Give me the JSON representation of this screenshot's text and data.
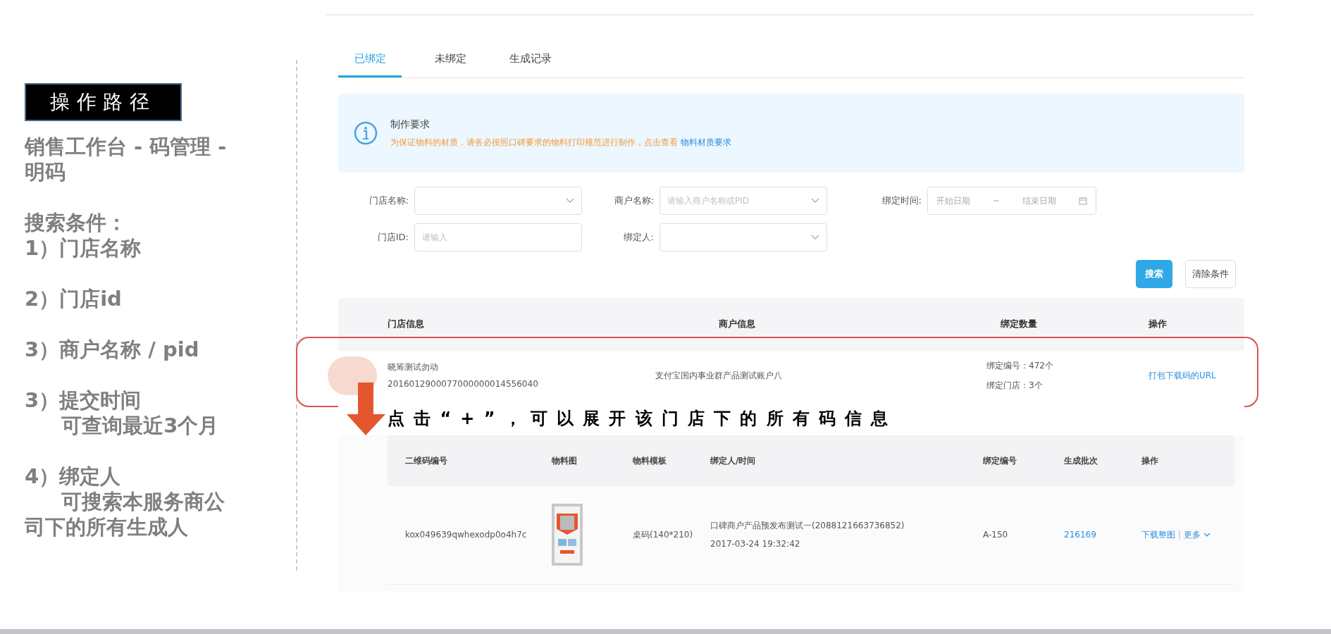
{
  "guide": {
    "badge": "操作路径",
    "path": "销售工作台 - 码管理 - 明码",
    "conditions_title": "搜索条件：",
    "conditions": [
      {
        "label": "1）门店名称"
      },
      {
        "label": "2）门店id"
      },
      {
        "label": "3）商户名称 / pid"
      },
      {
        "label": "3）提交时间",
        "note": "可查询最近3个月"
      },
      {
        "label": "4）绑定人",
        "note": "可搜索本服务商公司下的所有生成人"
      }
    ]
  },
  "tabs": [
    {
      "label": "已绑定",
      "selected": true
    },
    {
      "label": "未绑定",
      "selected": false
    },
    {
      "label": "生成记录",
      "selected": false
    }
  ],
  "notice": {
    "title": "制作要求",
    "text": "为保证物料的材质，请务必按照口碑要求的物料打印规范进行制作，点击查看",
    "link": "物料材质要求"
  },
  "filters": [
    {
      "kind": "select",
      "label": "门店名称:"
    },
    {
      "kind": "select",
      "label": "商户名称:",
      "placeholder": "请输入商户名称或PID"
    },
    {
      "kind": "range",
      "label": "绑定时间:",
      "start": "开始日期",
      "separator": "~",
      "end": "结束日期"
    },
    {
      "kind": "input",
      "label": "门店ID:",
      "placeholder": "请输入"
    },
    {
      "kind": "select",
      "label": "绑定人:"
    }
  ],
  "buttons": [
    {
      "label": "搜索",
      "kind": "primary"
    },
    {
      "label": "清除条件",
      "kind": "default"
    }
  ],
  "table": {
    "columns": [
      "门店信息",
      "商户信息",
      "绑定数量",
      "操作"
    ],
    "row": {
      "store_name": "晓筹测试勿动",
      "store_id": "2016012900077000000014556040",
      "merchant": "支付宝国内事业群产品测试账户八",
      "counts": [
        "绑定编号：472个",
        "绑定门店：3个"
      ],
      "action": "打包下载码的URL"
    }
  },
  "annotation": "点击“+”，可以展开该门店下的所有码信息",
  "code_table": {
    "columns": [
      "二维码编号",
      "物料图",
      "物料模板",
      "绑定人/时间",
      "绑定编号",
      "生成批次",
      "操作"
    ],
    "row": {
      "code": "kox049639qwhexodp0o4h7c",
      "template": "桌码(140*210)",
      "binder": "口碑商户产品预发布测试一(2088121663736852)",
      "time": "2017-03-24 19:32:42",
      "number": "A-150",
      "batch": "216169",
      "actions": [
        "下载整图",
        "更多"
      ],
      "separator": "|"
    }
  }
}
